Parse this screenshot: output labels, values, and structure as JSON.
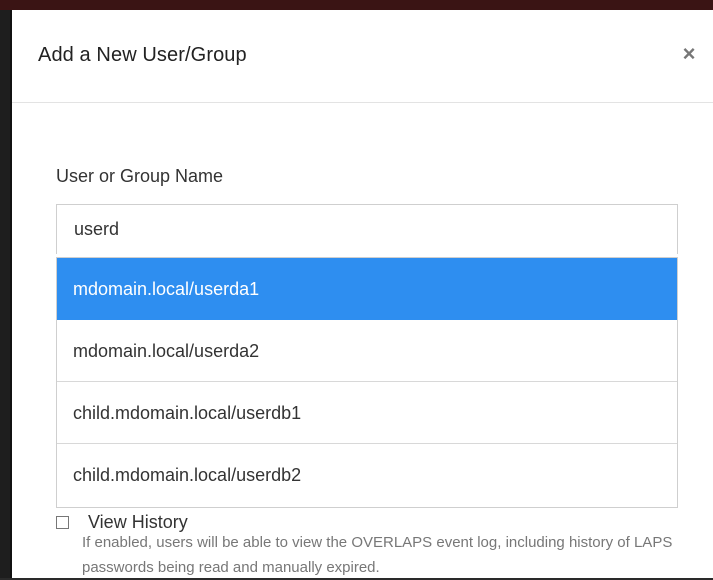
{
  "modal": {
    "title": "Add a New User/Group",
    "close_glyph": "×",
    "close_icon": "close-icon"
  },
  "form": {
    "field_label": "User or Group Name",
    "search_value": "userd"
  },
  "suggestions": [
    {
      "label": "mdomain.local/userda1",
      "highlighted": true
    },
    {
      "label": "mdomain.local/userda2",
      "highlighted": false
    },
    {
      "label": "child.mdomain.local/userdb1",
      "highlighted": false
    },
    {
      "label": "child.mdomain.local/userdb2",
      "highlighted": false
    }
  ],
  "option": {
    "label": "View History",
    "checked": false,
    "help": "If enabled, users will be able to view the OVERLAPS event log, including history of LAPS passwords being read and manually expired."
  },
  "colors": {
    "highlight": "#2e8ef0",
    "text": "#333333",
    "muted": "#777777"
  }
}
